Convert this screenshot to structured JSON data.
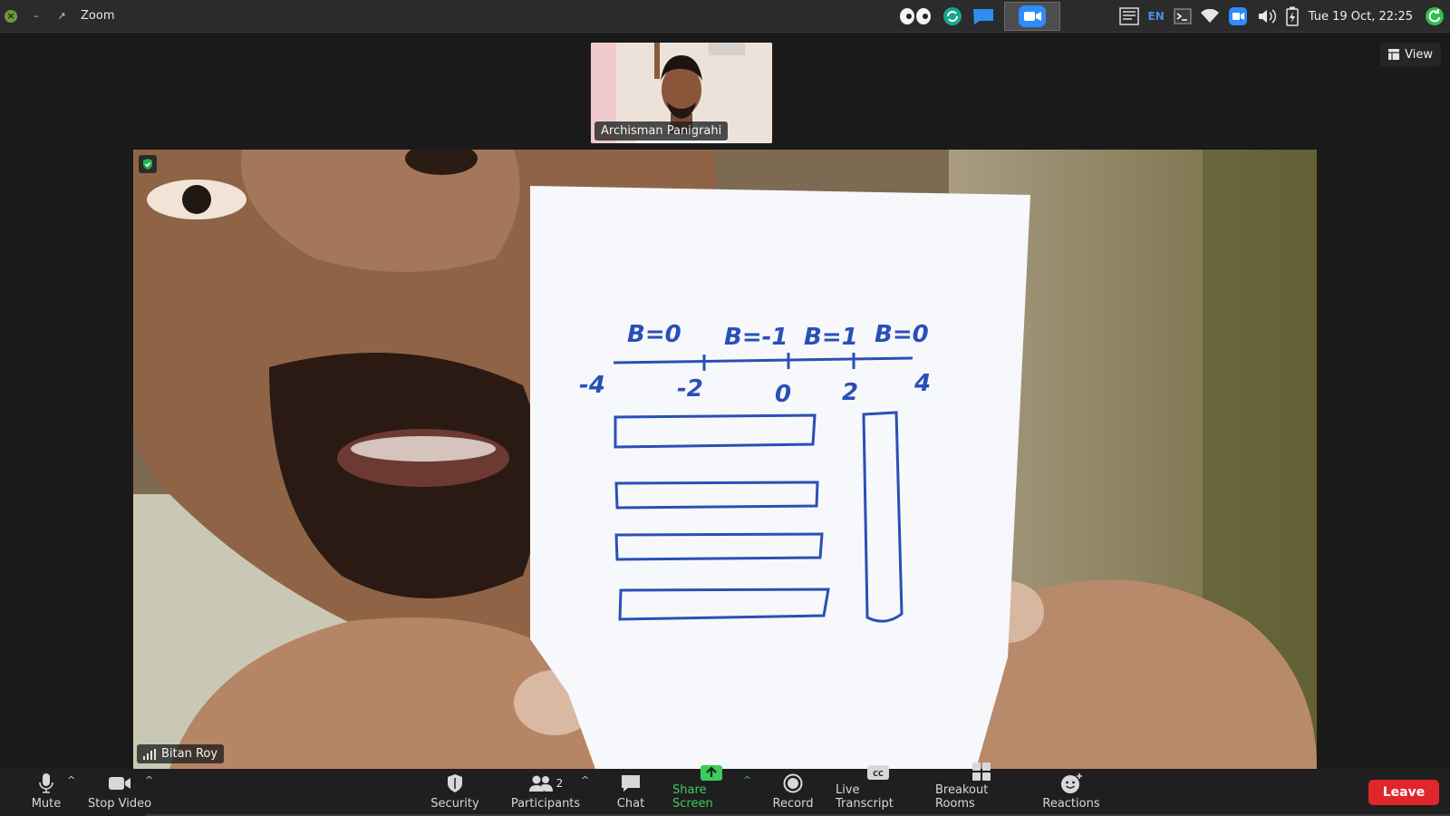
{
  "window": {
    "app_title": "Zoom"
  },
  "system_tray": {
    "language": "EN",
    "clock": "Tue 19 Oct, 22:25"
  },
  "view_button": {
    "label": "View"
  },
  "thumbnail_participant": {
    "name": "Archisman Panigrahi"
  },
  "main_participant": {
    "name": "Bitan Roy",
    "paper_drawing": {
      "top_labels": [
        "B=0",
        "B=-1",
        "B=1",
        "B=0"
      ],
      "axis_ticks": [
        "-4",
        "-2",
        "0",
        "2",
        "4"
      ]
    }
  },
  "toolbar": {
    "mute_label": "Mute",
    "stop_video_label": "Stop Video",
    "security_label": "Security",
    "participants_label": "Participants",
    "participants_count": "2",
    "chat_label": "Chat",
    "share_screen_label": "Share Screen",
    "record_label": "Record",
    "live_transcript_label": "Live Transcript",
    "breakout_rooms_label": "Breakout Rooms",
    "reactions_label": "Reactions",
    "leave_label": "Leave"
  },
  "colors": {
    "share_screen_accent": "#3fcb5a",
    "leave_button": "#e0262b",
    "zoom_brand": "#4d8ce8"
  }
}
